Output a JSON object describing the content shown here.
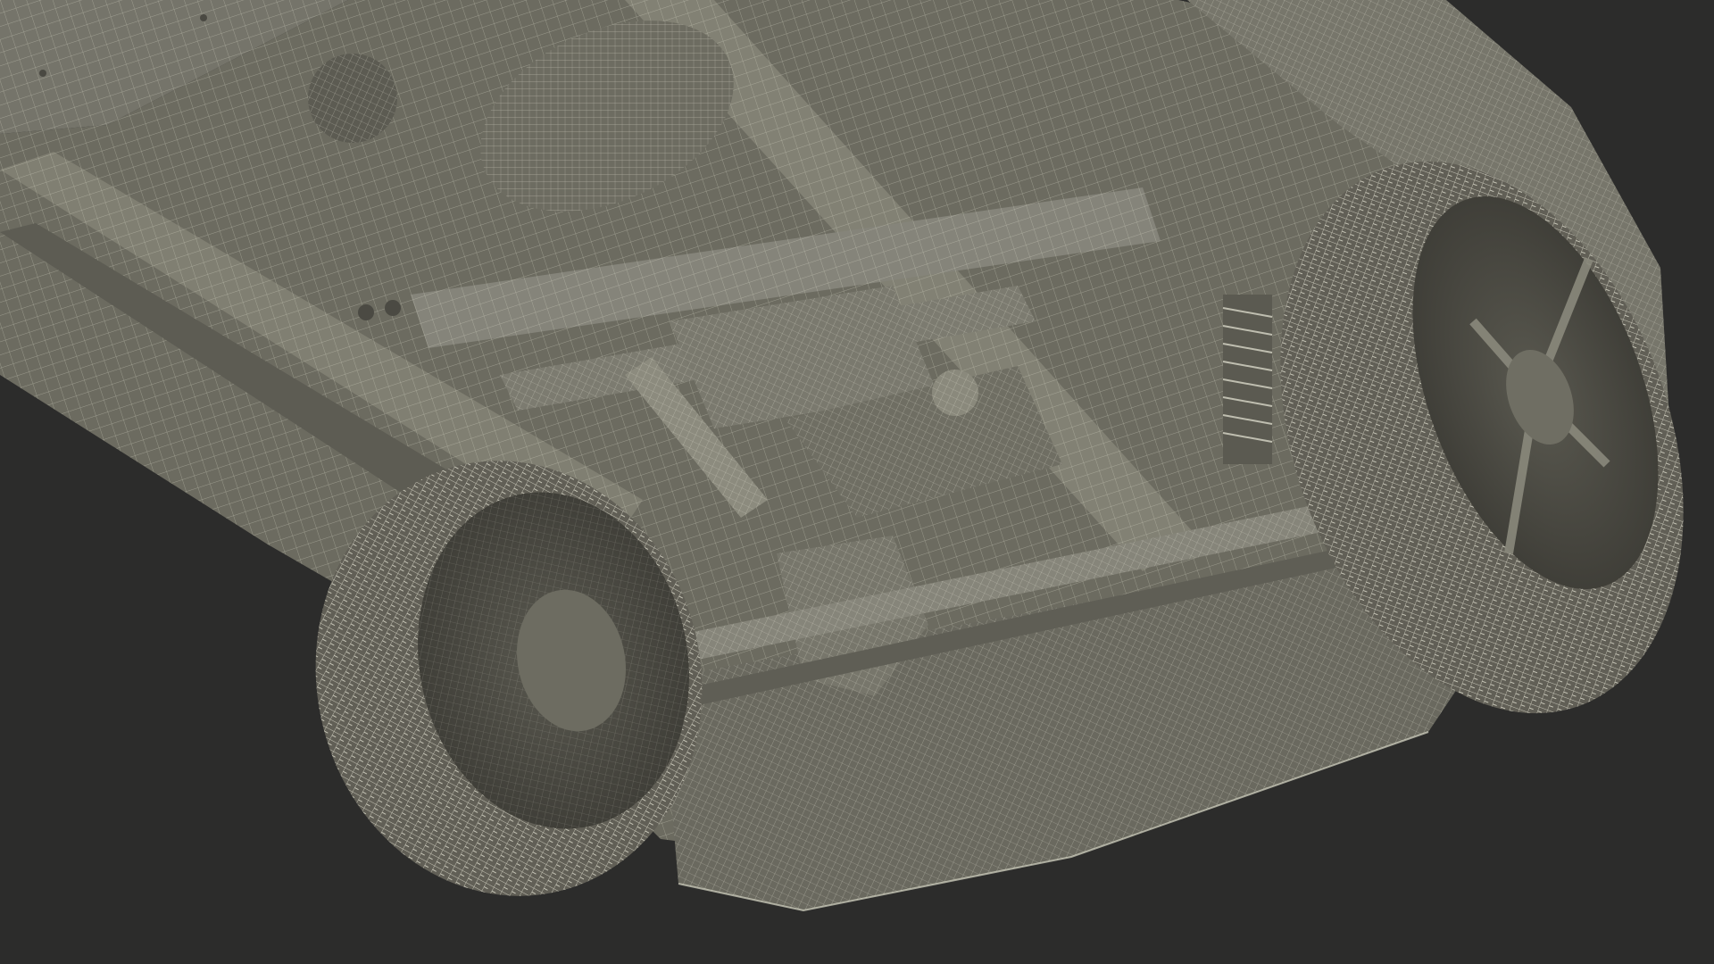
{
  "scene": {
    "subject": "pickup-truck-underside-wireframe",
    "colors": {
      "background": "#2c2c2b",
      "body": "#6f6e63",
      "body_light": "#8a897c",
      "body_dark": "#55544b",
      "wire": "#d9d8c8",
      "tire": "#5e5d54",
      "shadow": "#3a3a36"
    }
  }
}
